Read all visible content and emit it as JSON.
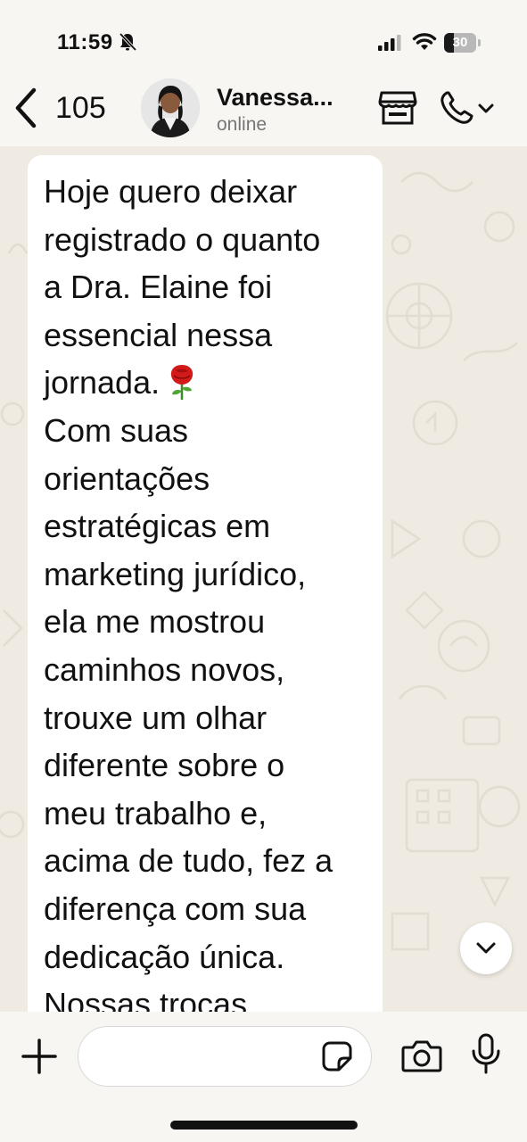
{
  "status_bar": {
    "time": "11:59",
    "battery_level": "30",
    "battery_fraction": 0.3,
    "icons": [
      "bell-muted-icon",
      "signal-icon",
      "wifi-icon",
      "battery-icon"
    ]
  },
  "header": {
    "back_count": "105",
    "contact_name": "Vanessa...",
    "contact_status": "online",
    "icons": [
      "back-chevron-icon",
      "avatar",
      "store-icon",
      "phone-icon",
      "chevron-down-icon"
    ]
  },
  "chat": {
    "message_text": "Hoje quero deixar\nregistrado o quanto\na Dra. Elaine foi\nessencial nessa\njornada.",
    "message_text_2": "\nCom suas\norientações\nestratégicas em\nmarketing jurídico,\nela me mostrou\ncaminhos novos,\ntrouxe um olhar\ndiferente sobre o\nmeu trabalho e,\nacima de tudo, fez a\ndiferença com sua\ndedicação única.\nNossas trocas",
    "emoji": "rose-emoji",
    "scroll_button_icon": "chevron-down-icon"
  },
  "input_bar": {
    "placeholder": "",
    "value": "",
    "icons": [
      "plus-icon",
      "sticker-icon",
      "camera-icon",
      "mic-icon"
    ]
  },
  "colors": {
    "background": "#f7f6f2",
    "chat_background": "#efeae2",
    "bubble": "#ffffff",
    "status_gray": "#767676"
  }
}
